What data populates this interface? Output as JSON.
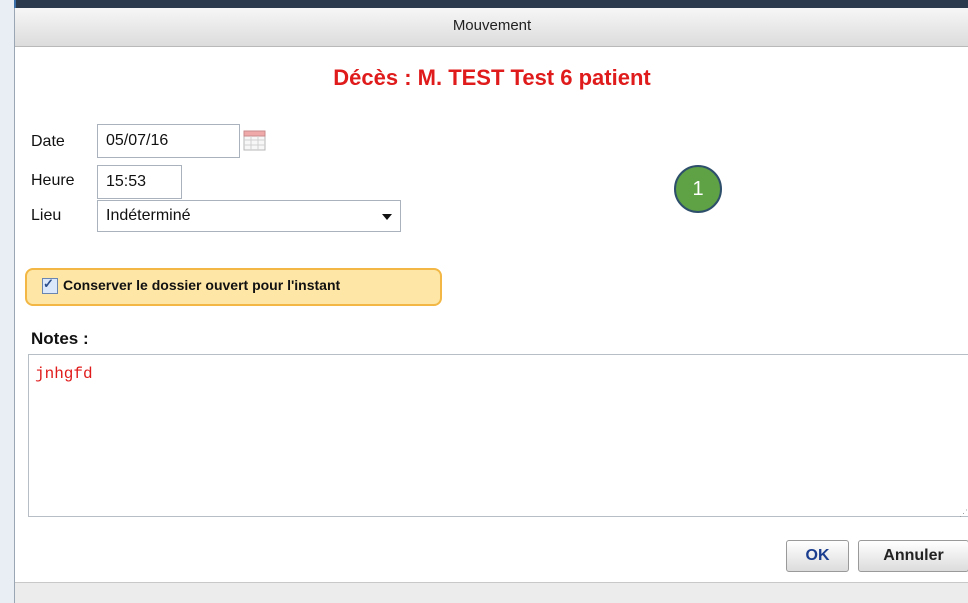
{
  "dialog": {
    "title": "Mouvement",
    "heading": "Décès : M. TEST Test 6 patient"
  },
  "form": {
    "date_label": "Date",
    "date_value": "05/07/16",
    "time_label": "Heure",
    "time_value": "15:53",
    "place_label": "Lieu",
    "place_value": "Indéterminé",
    "keep_open_label": "Conserver le dossier ouvert pour l'instant",
    "keep_open_checked": true
  },
  "notes": {
    "label": "Notes :",
    "value": "jnhgfd"
  },
  "buttons": {
    "ok": "OK",
    "cancel": "Annuler"
  },
  "annotation": {
    "marker": "1"
  },
  "colors": {
    "heading": "#e01b1b",
    "marker": "#5fa145",
    "keep_box": "#fde6a6"
  }
}
